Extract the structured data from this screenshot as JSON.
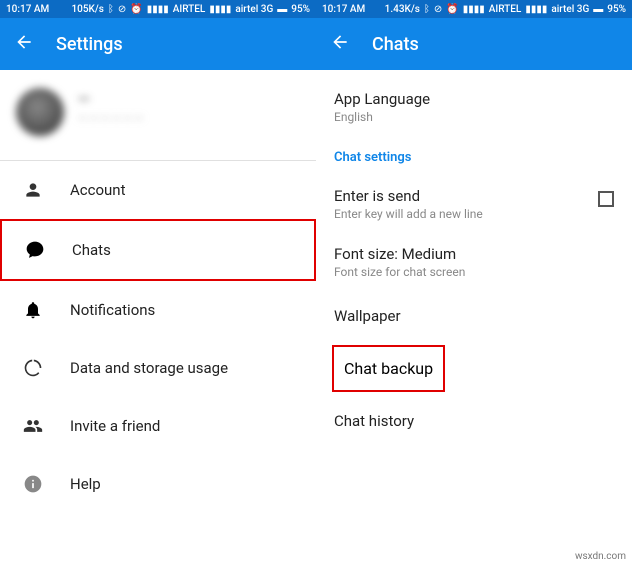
{
  "status": {
    "time_left": "10:17 AM",
    "time_right": "10:17 AM",
    "speed_left": "105K/s",
    "speed_right": "1.43K/s",
    "carrier": "AIRTEL",
    "network": "airtel 3G",
    "battery": "95%"
  },
  "left": {
    "title": "Settings",
    "profile_name": "—",
    "profile_sub": "— — — — — —",
    "items": [
      {
        "label": "Account"
      },
      {
        "label": "Chats"
      },
      {
        "label": "Notifications"
      },
      {
        "label": "Data and storage usage"
      },
      {
        "label": "Invite a friend"
      },
      {
        "label": "Help"
      }
    ]
  },
  "right": {
    "title": "Chats",
    "app_lang_title": "App Language",
    "app_lang_sub": "English",
    "section": "Chat settings",
    "enter_title": "Enter is send",
    "enter_sub": "Enter key will add a new line",
    "font_title": "Font size: Medium",
    "font_sub": "Font size for chat screen",
    "wallpaper": "Wallpaper",
    "chat_backup": "Chat backup",
    "chat_history": "Chat history"
  },
  "watermark": "wsxdn.com"
}
